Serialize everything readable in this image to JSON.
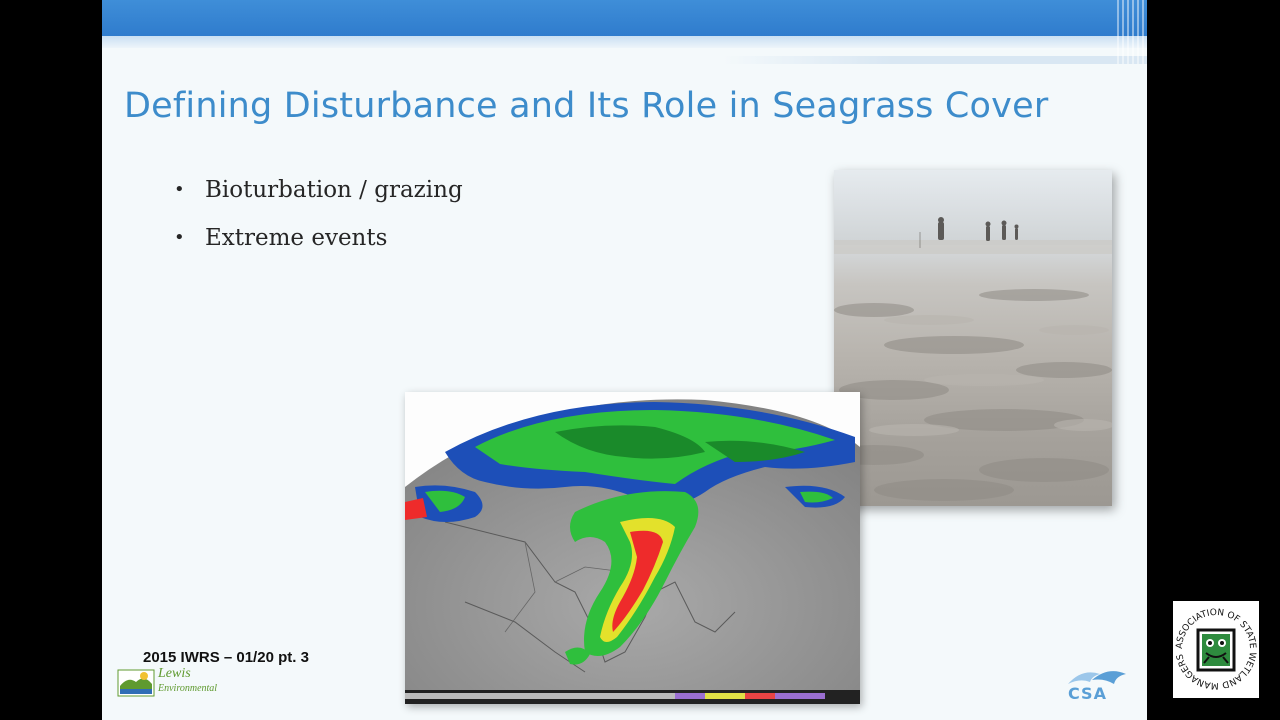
{
  "slide": {
    "title": "Defining Disturbance and Its Role in Seagrass Cover",
    "bullets": [
      "Bioturbation / grazing",
      "Extreme events"
    ]
  },
  "footer": {
    "session_label": "2015 IWRS – 01/20 pt. 3",
    "left_logo_name": "Lewis",
    "left_logo_sub": "Environmental",
    "right_logo_text": "CSA"
  },
  "overlay_logo": {
    "ring_text": "ASSOCIATION OF STATE WETLAND MANAGERS"
  },
  "images": {
    "photo": "tidal-flat-photo",
    "map": "satellite-storm-map"
  },
  "colors": {
    "header_blue": "#2f7ccd",
    "title_blue": "#3d8ccb",
    "slide_bg": "#f4f9fb",
    "logo_green": "#5f9a2f",
    "csa_blue": "#5a9fd6"
  }
}
